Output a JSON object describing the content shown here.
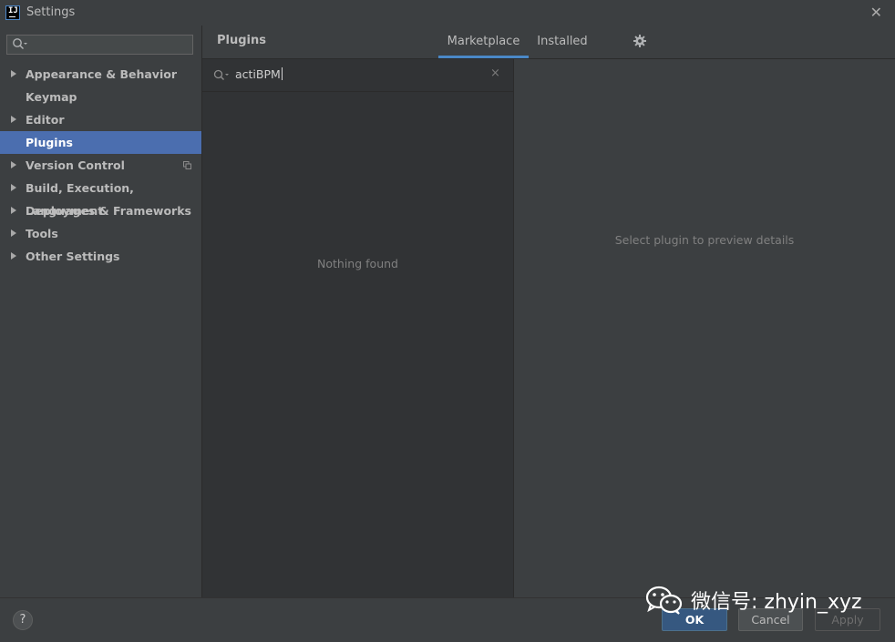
{
  "window": {
    "title": "Settings",
    "close_glyph": "✕"
  },
  "sidebar": {
    "search": {
      "value": "",
      "placeholder": ""
    },
    "items": [
      {
        "label": "Appearance & Behavior",
        "expandable": true
      },
      {
        "label": "Keymap",
        "expandable": false
      },
      {
        "label": "Editor",
        "expandable": true
      },
      {
        "label": "Plugins",
        "expandable": false,
        "selected": true
      },
      {
        "label": "Version Control",
        "expandable": true,
        "icon": "copy-icon"
      },
      {
        "label": "Build, Execution, Deployment",
        "expandable": true
      },
      {
        "label": "Languages & Frameworks",
        "expandable": true
      },
      {
        "label": "Tools",
        "expandable": true
      },
      {
        "label": "Other Settings",
        "expandable": true
      }
    ]
  },
  "header": {
    "title": "Plugins",
    "tabs": [
      {
        "label": "Marketplace",
        "active": true
      },
      {
        "label": "Installed",
        "active": false
      }
    ],
    "settings_icon": "gear-icon"
  },
  "plugins": {
    "search": {
      "value": "actiBPM",
      "clear_glyph": "×"
    },
    "empty_message": "Nothing found"
  },
  "details": {
    "message": "Select plugin to preview details"
  },
  "footer": {
    "help_label": "?",
    "ok_label": "OK",
    "cancel_label": "Cancel",
    "apply_label": "Apply"
  },
  "watermark": {
    "text": "微信号: zhyin_xyz",
    "icon": "wechat-icon"
  },
  "colors": {
    "accent": "#4b6eaf",
    "tab_underline": "#4a88c7",
    "ok_button": "#365880",
    "background": "#3c3f41",
    "list_background": "#313335"
  }
}
